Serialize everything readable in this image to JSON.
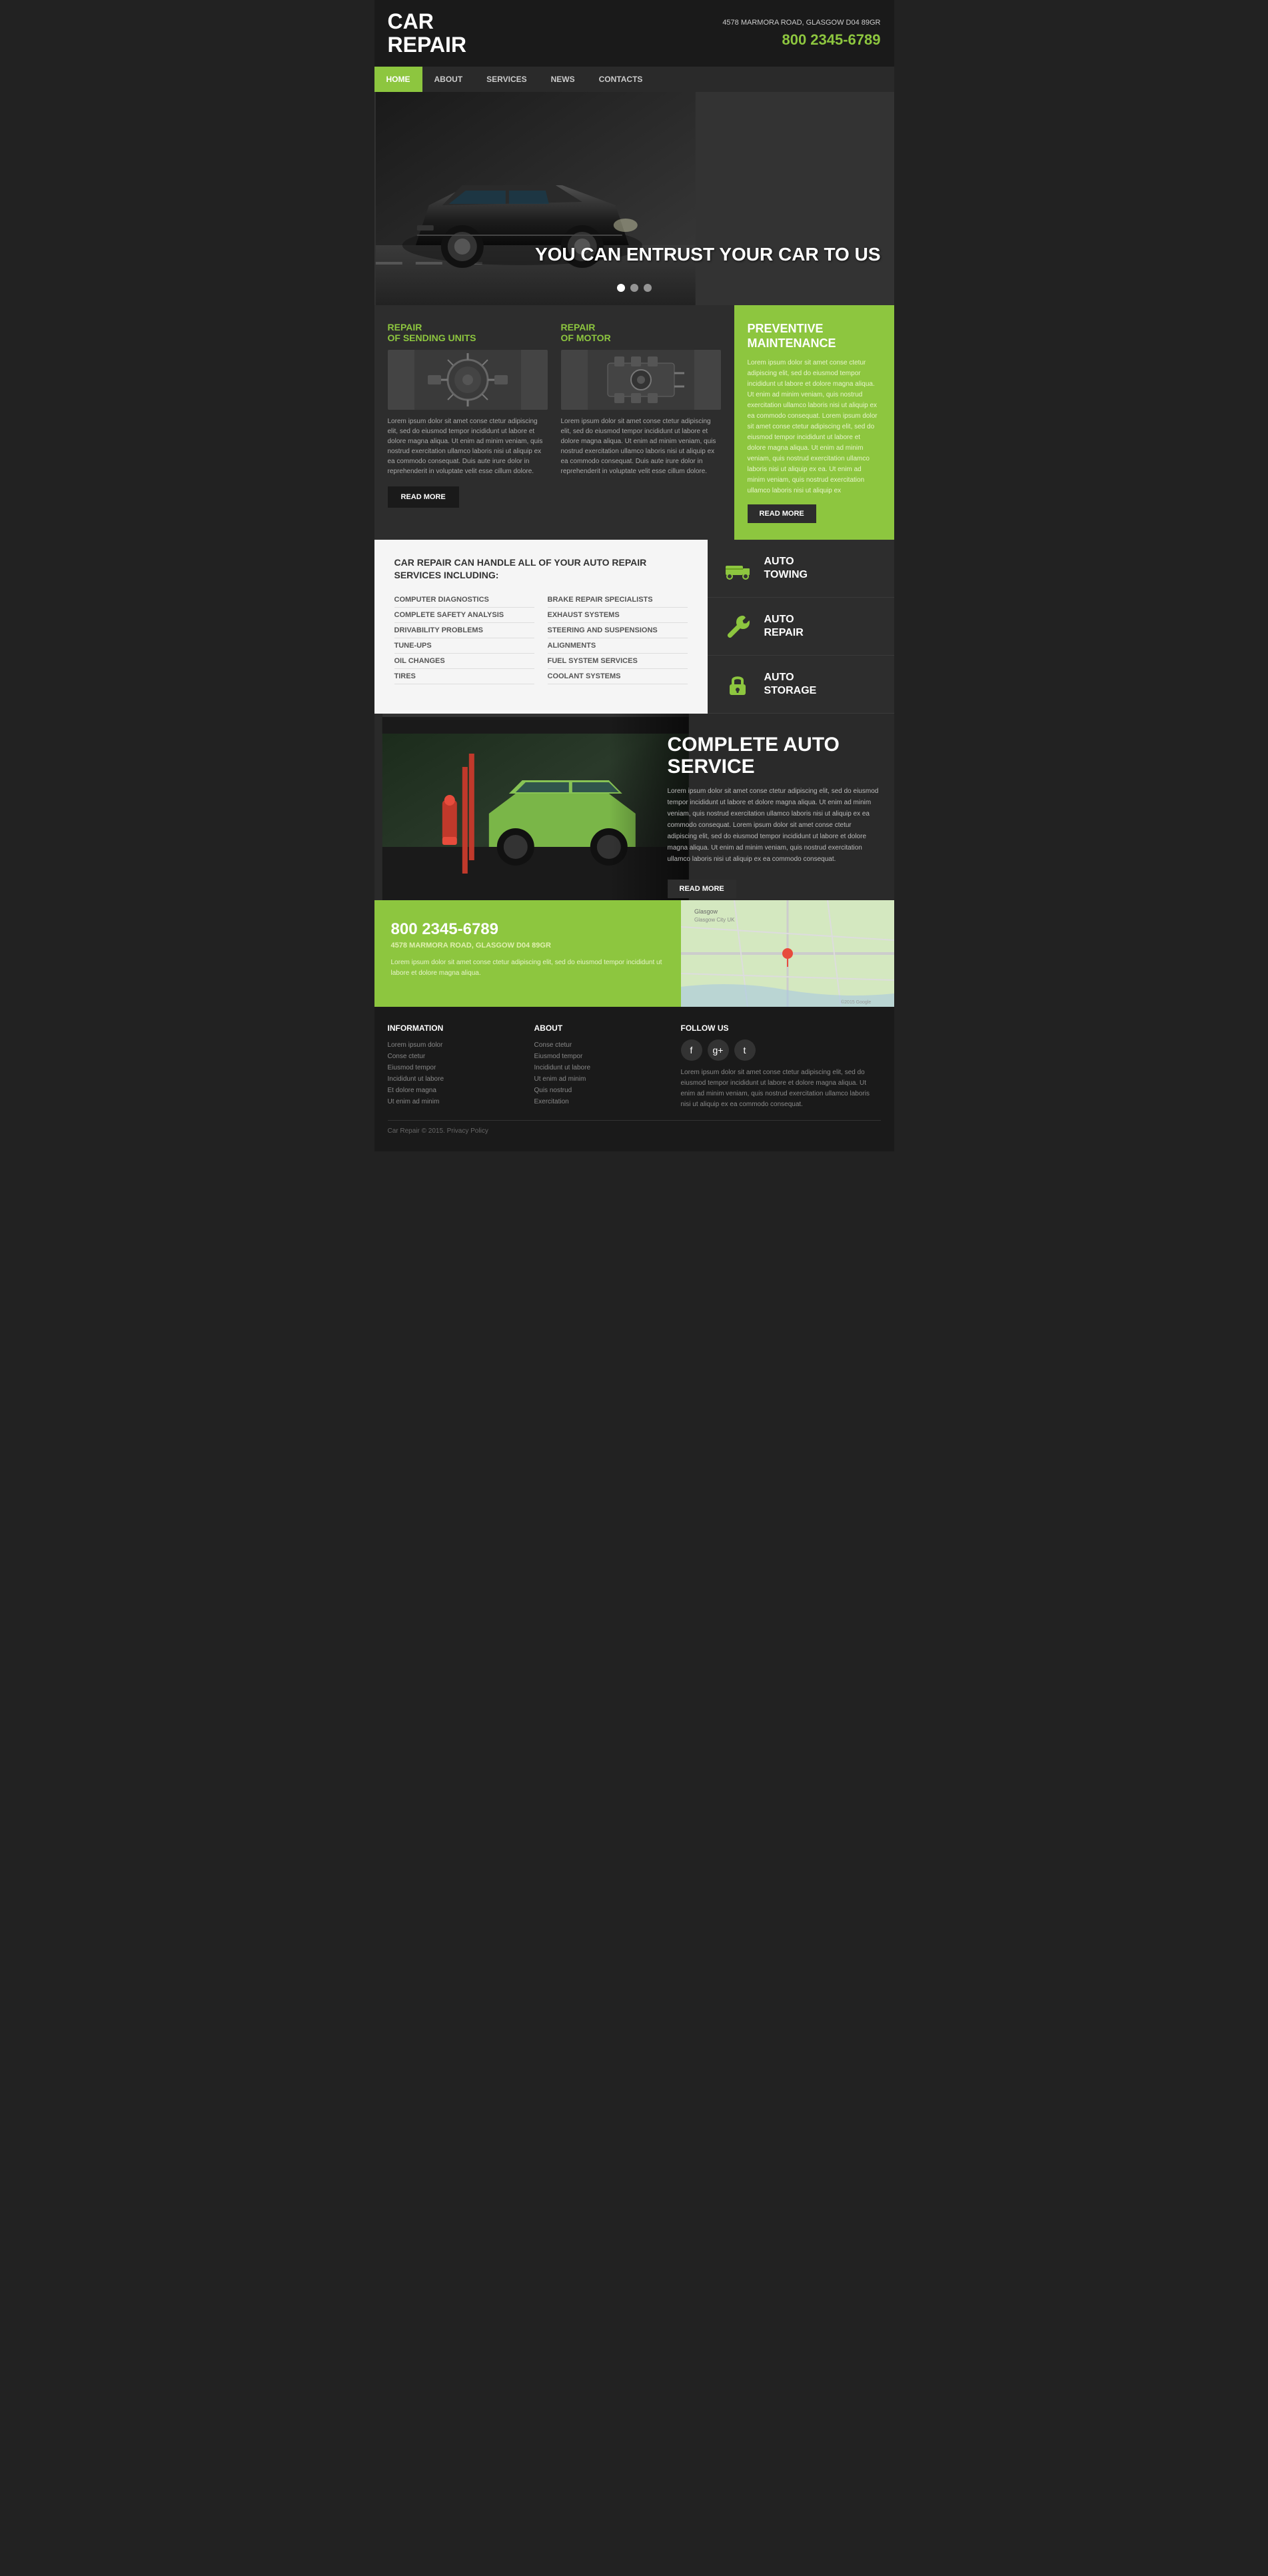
{
  "header": {
    "logo_line1": "CAR",
    "logo_line2": "REPAIR",
    "address": "4578 MARMORA ROAD, GLASGOW D04 89GR",
    "phone": "800 2345-6789"
  },
  "nav": {
    "items": [
      {
        "label": "HOME",
        "active": true
      },
      {
        "label": "ABOUT",
        "active": false
      },
      {
        "label": "SERVICES",
        "active": false
      },
      {
        "label": "NEWS",
        "active": false
      },
      {
        "label": "CONTACTS",
        "active": false
      }
    ]
  },
  "hero": {
    "tagline": "YOU CAN ENTRUST YOUR CAR TO US",
    "dots": 3,
    "active_dot": 0
  },
  "services": {
    "item1": {
      "title": "REPAIR",
      "subtitle": "OF SENDING UNITS",
      "desc": "Lorem ipsum dolor sit amet conse ctetur adipiscing elit, sed do eiusmod tempor incididunt ut labore et dolore magna aliqua. Ut enim ad minim veniam, quis nostrud exercitation ullamco laboris nisi ut aliquip ex ea commodo consequat. Duis aute irure dolor in reprehenderit in voluptate velit esse cillum dolore."
    },
    "item2": {
      "title": "REPAIR",
      "subtitle": "OF MOTOR",
      "desc": "Lorem ipsum dolor sit amet conse ctetur adipiscing elit, sed do eiusmod tempor incididunt ut labore et dolore magna aliqua. Ut enim ad minim veniam, quis nostrud exercitation ullamco laboris nisi ut aliquip ex ea commodo consequat. Duis aute irure dolor in reprehenderit in voluptate velit esse cillum dolore."
    },
    "maintenance": {
      "title": "PREVENTIVE MAINTENANCE",
      "desc": "Lorem ipsum dolor sit amet conse ctetur adipiscing elit, sed do eiusmod tempor incididunt ut labore et dolore magna aliqua. Ut enim ad minim veniam, quis nostrud exercitation ullamco laboris nisi ut aliquip ex ea commodo consequat. Lorem ipsum dolor sit amet conse ctetur adipiscing elit, sed do eiusmod tempor incididunt ut labore et dolore magna aliqua. Ut enim ad minim veniam, quis nostrud exercitation ullamco laboris nisi ut aliquip ex ea. Ut enim ad minim veniam, quis nostrud exercitation ullamco laboris nisi ut aliquip ex",
      "btn": "READ MORE"
    },
    "read_more": "READ MORE"
  },
  "auto_services": {
    "heading": "CAR REPAIR CAN HANDLE ALL OF YOUR AUTO REPAIR SERVICES INCLUDING:",
    "list_left": [
      "COMPUTER DIAGNOSTICS",
      "COMPLETE SAFETY ANALYSIS",
      "DRIVABILITY PROBLEMS",
      "TUNE-UPS",
      "OIL CHANGES",
      "TIRES"
    ],
    "list_right": [
      "BRAKE REPAIR SPECIALISTS",
      "EXHAUST SYSTEMS",
      "STEERING AND SUSPENSIONS",
      "ALIGNMENTS",
      "FUEL SYSTEM SERVICES",
      "COOLANT SYSTEMS"
    ]
  },
  "service_cards": [
    {
      "title": "AUTO\nTOWING",
      "icon": "truck"
    },
    {
      "title": "AUTO\nREPAIR",
      "icon": "wrench"
    },
    {
      "title": "AUTO\nSTORAGE",
      "icon": "lock"
    }
  ],
  "complete_service": {
    "title": "COMPLETE AUTO SERVICE",
    "desc": "Lorem ipsum dolor sit amet conse ctetur adipiscing elit, sed do eiusmod tempor incididunt ut labore et dolore magna aliqua. Ut enim ad minim veniam, quis nostrud exercitation ullamco laboris nisi ut aliquip ex ea commodo consequat. Lorem ipsum dolor sit amet conse ctetur adipiscing elit, sed do eiusmod tempor incididunt ut labore et dolore magna aliqua. Ut enim ad minim veniam, quis nostrud exercitation ullamco laboris nisi ut aliquip ex ea commodo consequat.",
    "btn": "READ MORE"
  },
  "contact": {
    "phone": "800 2345-6789",
    "address": "4578 MARMORA ROAD, GLASGOW D04 89GR",
    "desc": "Lorem ipsum dolor sit amet conse ctetur adipiscing elit, sed do eiusmod tempor incididunt ut labore et dolore magna aliqua."
  },
  "footer": {
    "info_title": "INFORMATION",
    "info_items": [
      "Lorem ipsum dolor",
      "Conse ctetur",
      "Eiusmod tempor",
      "Incididunt ut labore",
      "Et dolore magna",
      "Ut enim ad minim"
    ],
    "about_title": "ABOUT",
    "about_items": [
      "Conse ctetur",
      "Eiusmod tempor",
      "Incididunt ut labore",
      "Ut enim ad minim",
      "Quis nostrud",
      "Exercitation"
    ],
    "follow_title": "FOLLOW US",
    "social_icons": [
      "f",
      "g+",
      "t"
    ],
    "right_text": "Lorem ipsum dolor sit amet conse ctetur adipiscing elit, sed do eiusmod tempor incididunt ut labore et dolore magna aliqua. Ut enim ad minim veniam, quis nostrud exercitation ullamco laboris nisi ut aliquip ex ea commodo consequat.",
    "copyright": "Car Repair © 2015. Privacy Policy"
  }
}
